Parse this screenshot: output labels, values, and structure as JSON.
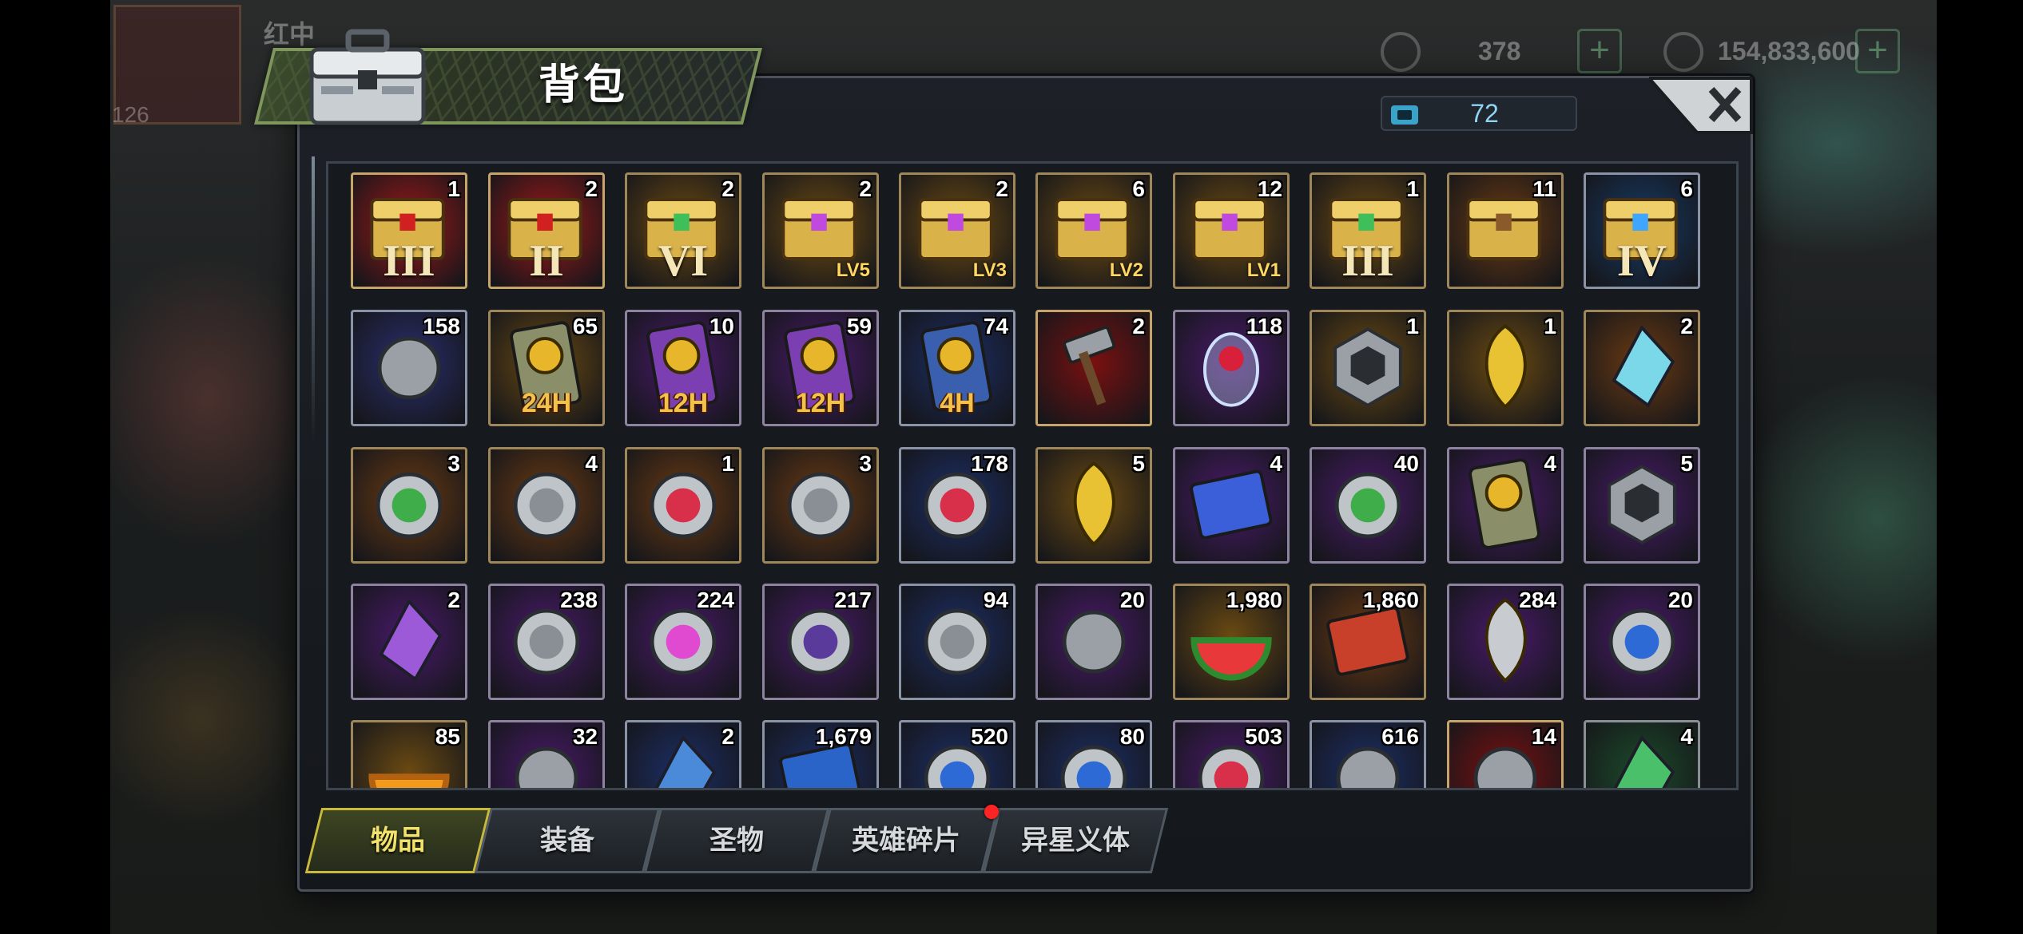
{
  "hud": {
    "player_name": "红中",
    "level": "126",
    "resource1": "378",
    "resource2": "154,833,600",
    "plus": "+"
  },
  "panel": {
    "title": "背包",
    "capacity": "72",
    "close_label": "✕"
  },
  "tabs": [
    {
      "label": "物品",
      "active": true
    },
    {
      "label": "装备",
      "active": false
    },
    {
      "label": "圣物",
      "active": false
    },
    {
      "label": "英雄碎片",
      "active": false,
      "badge": true
    },
    {
      "label": "异星义体",
      "active": false
    }
  ],
  "items": [
    {
      "count": "1",
      "icon": "red-gold-chest-icon",
      "bg": "#a01818",
      "glyph": "III"
    },
    {
      "count": "2",
      "icon": "red-gold-chest-icon",
      "bg": "#a01818",
      "glyph": "II"
    },
    {
      "count": "2",
      "icon": "green-gold-chest-icon",
      "bg": "#6b4a12",
      "glyph": "VI"
    },
    {
      "count": "2",
      "icon": "crystal-chest-icon",
      "bg": "#6b4a12",
      "glyph": "LV5"
    },
    {
      "count": "2",
      "icon": "crystal-chest-icon",
      "bg": "#6b4a12",
      "glyph": "LV3"
    },
    {
      "count": "6",
      "icon": "crystal-chest-icon",
      "bg": "#6b4a12",
      "glyph": "LV2"
    },
    {
      "count": "12",
      "icon": "crystal-chest-icon",
      "bg": "#6b4a12",
      "glyph": "LV1"
    },
    {
      "count": "1",
      "icon": "green-gold-chest-icon",
      "bg": "#6b4a12",
      "glyph": "III"
    },
    {
      "count": "11",
      "icon": "bronze-chest-icon",
      "bg": "#6b3a12",
      "glyph": ""
    },
    {
      "count": "6",
      "icon": "blue-diamond-chest-icon",
      "bg": "#173a66",
      "glyph": "IV"
    },
    {
      "count": "158",
      "icon": "speed-boot-icon",
      "bg": "#2a2e6e",
      "glyph": ""
    },
    {
      "count": "65",
      "icon": "speedup-card-icon",
      "bg": "#6b4a12",
      "tag": "24H"
    },
    {
      "count": "10",
      "icon": "purple-speedup-card-icon",
      "bg": "#4a1a6b",
      "tag": "12H"
    },
    {
      "count": "59",
      "icon": "purple-speedup-card-icon",
      "bg": "#4a1a6b",
      "tag": "12H"
    },
    {
      "count": "74",
      "icon": "blue-speedup-card-icon",
      "bg": "#1c2e66",
      "tag": "4H"
    },
    {
      "count": "2",
      "icon": "hammer-icon",
      "bg": "#7a1010",
      "glyph": ""
    },
    {
      "count": "118",
      "icon": "rose-dome-icon",
      "bg": "#4a1a6b",
      "glyph": ""
    },
    {
      "count": "1",
      "icon": "metal-cube-icon",
      "bg": "#6b4a12",
      "glyph": ""
    },
    {
      "count": "1",
      "icon": "gold-feather-icon",
      "bg": "#6b4a12",
      "glyph": ""
    },
    {
      "count": "2",
      "icon": "diamond-prism-icon",
      "bg": "#6b3a12",
      "glyph": ""
    },
    {
      "count": "3",
      "icon": "green-leaf-badge-icon",
      "bg": "#6b3a12",
      "glyph": ""
    },
    {
      "count": "4",
      "icon": "silver-coin-icon",
      "bg": "#6b3a12",
      "glyph": ""
    },
    {
      "count": "1",
      "icon": "red-target-badge-icon",
      "bg": "#6b3a12",
      "glyph": ""
    },
    {
      "count": "3",
      "icon": "radiation-coin-icon",
      "bg": "#6b3a12",
      "glyph": ""
    },
    {
      "count": "178",
      "icon": "red-gem-cap-icon",
      "bg": "#1c2e66",
      "glyph": ""
    },
    {
      "count": "5",
      "icon": "gold-trophy-icon",
      "bg": "#6b4a12",
      "glyph": ""
    },
    {
      "count": "4",
      "icon": "ticket-stack-icon",
      "bg": "#4a1a6b",
      "glyph": ""
    },
    {
      "count": "40",
      "icon": "wheat-medal-icon",
      "bg": "#4a1a6b",
      "glyph": ""
    },
    {
      "count": "4",
      "icon": "heart-card-icon",
      "bg": "#4a1a6b",
      "glyph": ""
    },
    {
      "count": "5",
      "icon": "purple-cube-icon",
      "bg": "#4a1a6b",
      "glyph": ""
    },
    {
      "count": "2",
      "icon": "purple-crystal-icon",
      "bg": "#4a1a6b",
      "glyph": ""
    },
    {
      "count": "238",
      "icon": "film-reel-icon",
      "bg": "#4a1a6b",
      "glyph": ""
    },
    {
      "count": "224",
      "icon": "pink-cap-icon",
      "bg": "#4a1a6b",
      "glyph": ""
    },
    {
      "count": "217",
      "icon": "poker-chip-icon",
      "bg": "#4a1a6b",
      "glyph": ""
    },
    {
      "count": "94",
      "icon": "police-badge-icon",
      "bg": "#1c2e66",
      "glyph": ""
    },
    {
      "count": "20",
      "icon": "silver-tool-icon",
      "bg": "#4a1a6b",
      "glyph": ""
    },
    {
      "count": "1,980",
      "icon": "watermelon-icon",
      "bg": "#6b4a12",
      "glyph": ""
    },
    {
      "count": "1,860",
      "icon": "red-ticket-icon",
      "bg": "#6b3a12",
      "glyph": ""
    },
    {
      "count": "284",
      "icon": "silver-bell-icon",
      "bg": "#4a1a6b",
      "glyph": ""
    },
    {
      "count": "20",
      "icon": "duck-ball-icon",
      "bg": "#4a1a6b",
      "glyph": ""
    },
    {
      "count": "85",
      "icon": "orange-fruit-icon",
      "bg": "#6b4a12",
      "glyph": ""
    },
    {
      "count": "32",
      "icon": "gift-box-icon",
      "bg": "#4a1a6b",
      "glyph": ""
    },
    {
      "count": "2",
      "icon": "blue-crystal-icon",
      "bg": "#1c2e66",
      "glyph": ""
    },
    {
      "count": "1,679",
      "icon": "cinema-ticket-icon",
      "bg": "#1c2e66",
      "glyph": ""
    },
    {
      "count": "520",
      "icon": "timer-clock-icon",
      "bg": "#1c2e66",
      "glyph": ""
    },
    {
      "count": "80",
      "icon": "blue-b-coin-icon",
      "bg": "#1c2e66",
      "glyph": ""
    },
    {
      "count": "503",
      "icon": "red-chip-icon",
      "bg": "#4a1a6b",
      "glyph": ""
    },
    {
      "count": "616",
      "icon": "bullet-icon",
      "bg": "#1c2e66",
      "glyph": ""
    },
    {
      "count": "14",
      "icon": "red-ornament-icon",
      "bg": "#7a1010",
      "glyph": ""
    },
    {
      "count": "4",
      "icon": "green-crystal-icon",
      "bg": "#1c4a2a",
      "glyph": ""
    }
  ]
}
